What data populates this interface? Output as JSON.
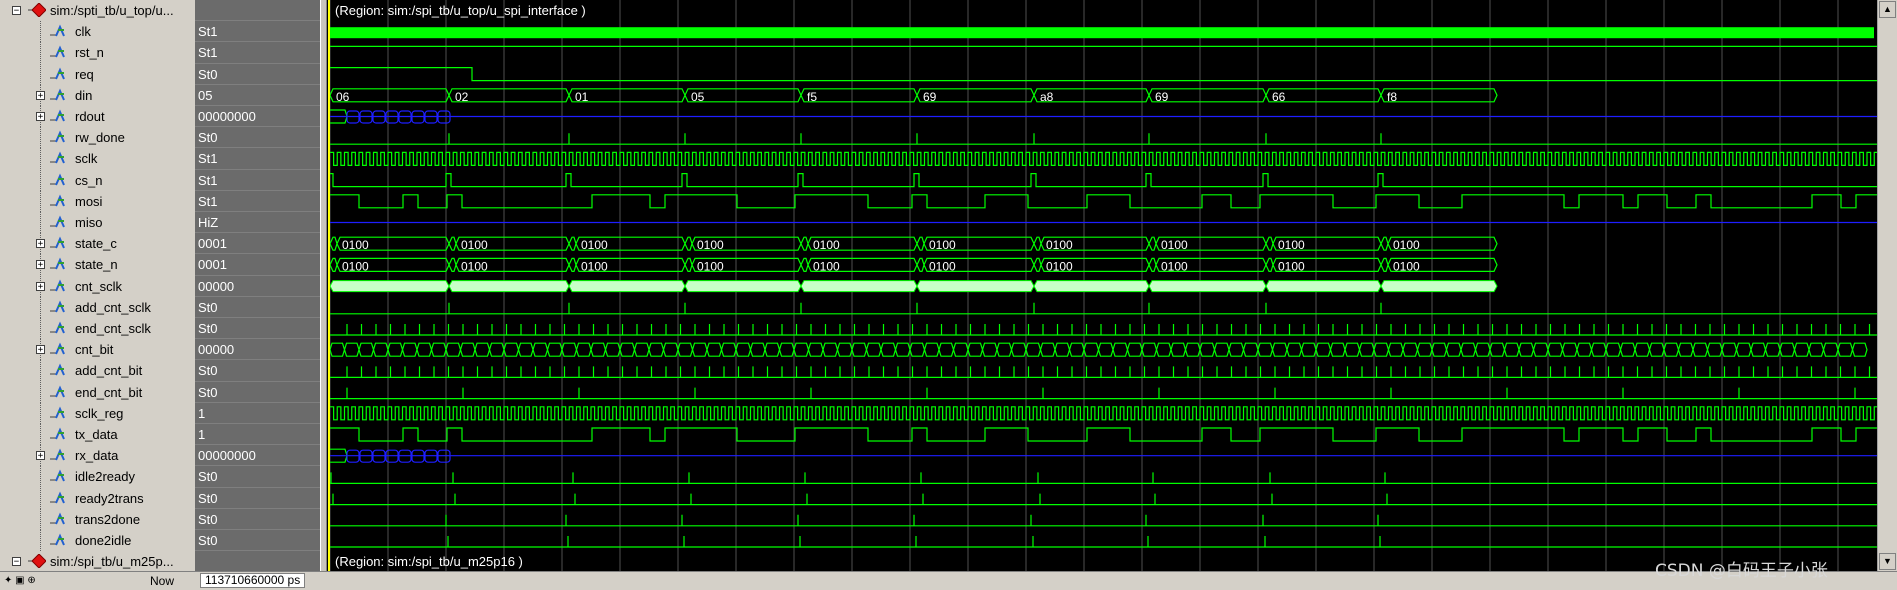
{
  "groups": [
    {
      "name": "sim:/spti_tb/u_top/u...",
      "region": "(Region: sim:/spi_tb/u_top/u_spi_interface )"
    },
    {
      "name": "sim:/spi_tb/u_m25p...",
      "region": "(Region: sim:/spi_tb/u_m25p16 )"
    }
  ],
  "signals": [
    {
      "name": "clk",
      "value": "St1",
      "expandable": false
    },
    {
      "name": "rst_n",
      "value": "St1",
      "expandable": false
    },
    {
      "name": "req",
      "value": "St0",
      "expandable": false
    },
    {
      "name": "din",
      "value": "05",
      "expandable": true
    },
    {
      "name": "rdout",
      "value": "00000000",
      "expandable": true
    },
    {
      "name": "rw_done",
      "value": "St0",
      "expandable": false
    },
    {
      "name": "sclk",
      "value": "St1",
      "expandable": false
    },
    {
      "name": "cs_n",
      "value": "St1",
      "expandable": false
    },
    {
      "name": "mosi",
      "value": "St1",
      "expandable": false
    },
    {
      "name": "miso",
      "value": "HiZ",
      "expandable": false
    },
    {
      "name": "state_c",
      "value": "0001",
      "expandable": true
    },
    {
      "name": "state_n",
      "value": "0001",
      "expandable": true
    },
    {
      "name": "cnt_sclk",
      "value": "00000",
      "expandable": true
    },
    {
      "name": "add_cnt_sclk",
      "value": "St0",
      "expandable": false
    },
    {
      "name": "end_cnt_sclk",
      "value": "St0",
      "expandable": false
    },
    {
      "name": "cnt_bit",
      "value": "00000",
      "expandable": true
    },
    {
      "name": "add_cnt_bit",
      "value": "St0",
      "expandable": false
    },
    {
      "name": "end_cnt_bit",
      "value": "St0",
      "expandable": false
    },
    {
      "name": "sclk_reg",
      "value": "1",
      "expandable": false
    },
    {
      "name": "tx_data",
      "value": "1",
      "expandable": false
    },
    {
      "name": "rx_data",
      "value": "00000000",
      "expandable": true
    },
    {
      "name": "idle2ready",
      "value": "St0",
      "expandable": false
    },
    {
      "name": "ready2trans",
      "value": "St0",
      "expandable": false
    },
    {
      "name": "trans2done",
      "value": "St0",
      "expandable": false
    },
    {
      "name": "done2idle",
      "value": "St0",
      "expandable": false
    }
  ],
  "din_labels": [
    "06",
    "02",
    "01",
    "05",
    "f5",
    "69",
    "a8",
    "69",
    "66",
    "f8"
  ],
  "state_label": "0100",
  "status": {
    "now_label": "Now",
    "now_value": "113710660000 ps"
  },
  "watermark": "CSDN @白码王子小张",
  "colors": {
    "wave": "#00ff00",
    "bus_bg": "#c8ffc8",
    "blue": "#1e1eff",
    "cursor": "#ffff00",
    "grid": "#505050"
  },
  "icons": {
    "group": "red-diamond-icon",
    "signal": "signal-waveform-icon",
    "expand": "plus-box-icon",
    "collapse": "minus-box-icon"
  }
}
